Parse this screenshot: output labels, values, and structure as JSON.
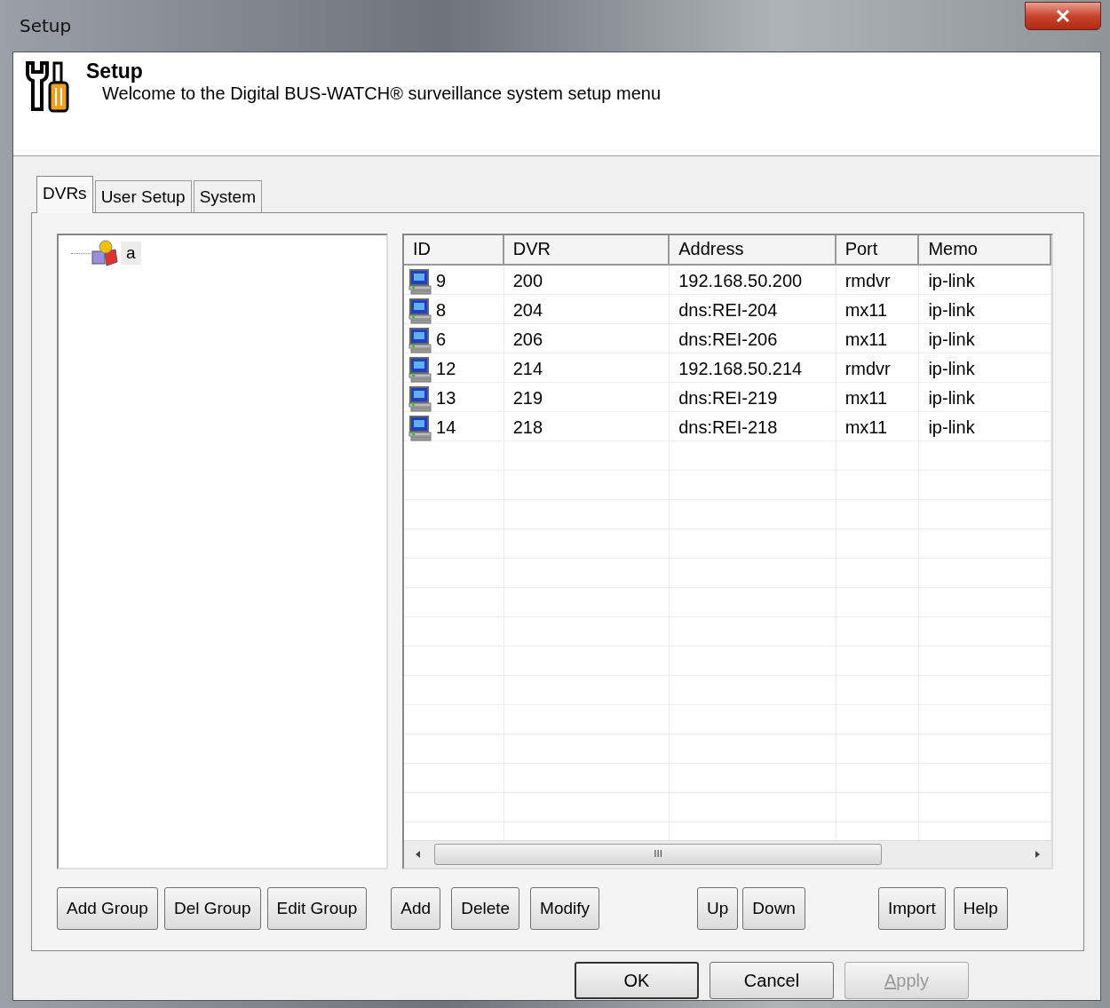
{
  "window": {
    "title": "Setup"
  },
  "header": {
    "title": "Setup",
    "subtitle": "Welcome to the Digital BUS-WATCH® surveillance system setup menu"
  },
  "tabs": [
    {
      "label": "DVRs",
      "selected": true
    },
    {
      "label": "User Setup",
      "selected": false
    },
    {
      "label": "System",
      "selected": false
    }
  ],
  "tree": {
    "items": [
      {
        "label": "a",
        "selected": true
      }
    ]
  },
  "table": {
    "columns": [
      "ID",
      "DVR",
      "Address",
      "Port",
      "Memo"
    ],
    "rows": [
      {
        "cells": [
          "9",
          "200",
          "192.168.50.200",
          "rmdvr",
          "ip-link"
        ]
      },
      {
        "cells": [
          "8",
          "204",
          "dns:REI-204",
          "mx11",
          "ip-link"
        ]
      },
      {
        "cells": [
          "6",
          "206",
          "dns:REI-206",
          "mx11",
          "ip-link"
        ]
      },
      {
        "cells": [
          "12",
          "214",
          "192.168.50.214",
          "rmdvr",
          "ip-link"
        ]
      },
      {
        "cells": [
          "13",
          "219",
          "dns:REI-219",
          "mx11",
          "ip-link"
        ]
      },
      {
        "cells": [
          "14",
          "218",
          "dns:REI-218",
          "mx11",
          "ip-link"
        ]
      }
    ],
    "scrollbar_grip": "III"
  },
  "group_buttons": [
    "Add Group",
    "Del Group",
    "Edit Group"
  ],
  "dvr_buttons": [
    "Add",
    "Delete",
    "Modify"
  ],
  "order_buttons": [
    "Up",
    "Down"
  ],
  "extra_buttons": [
    "Import",
    "Help"
  ],
  "dialog_buttons": [
    {
      "label": "OK",
      "disabled": false
    },
    {
      "label": "Cancel",
      "disabled": false
    },
    {
      "label": "Apply",
      "disabled": true
    }
  ]
}
